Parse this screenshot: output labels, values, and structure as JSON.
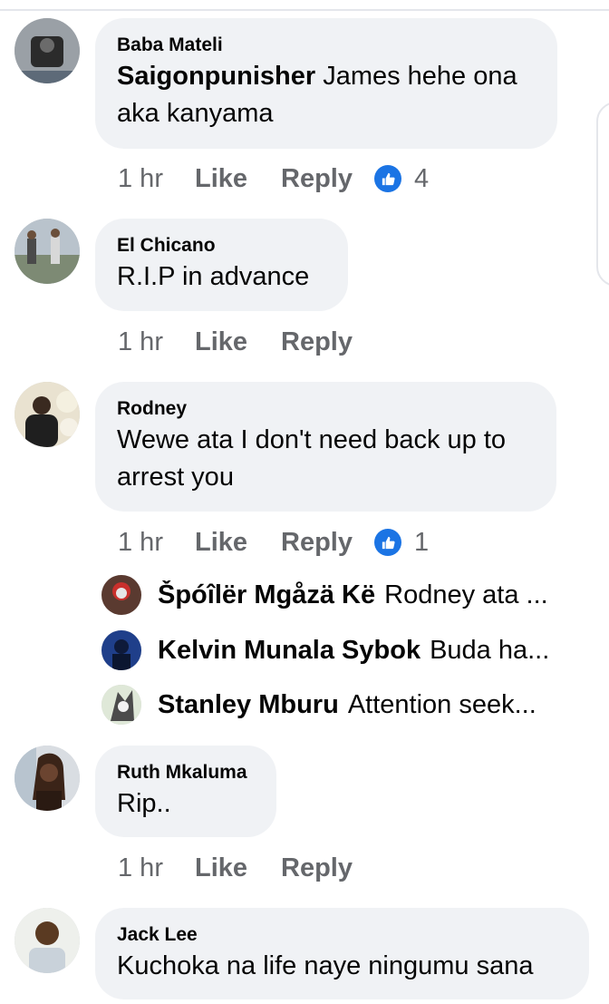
{
  "comments": [
    {
      "author": "Baba Mateli",
      "mention": "Saigonpunisher",
      "text": " James hehe ona aka kanyama",
      "time": "1 hr",
      "like": "Like",
      "reply": "Reply",
      "reactions": "4"
    },
    {
      "author": "El Chicano",
      "text": "R.I.P in advance",
      "time": "1 hr",
      "like": "Like",
      "reply": "Reply"
    },
    {
      "author": "Rodney",
      "text": "Wewe ata I don't need back up to arrest you",
      "time": "1 hr",
      "like": "Like",
      "reply": "Reply",
      "reactions": "1"
    },
    {
      "author": "Ruth Mkaluma",
      "text": "Rip..",
      "time": "1 hr",
      "like": "Like",
      "reply": "Reply"
    },
    {
      "author": "Jack Lee",
      "text": "Kuchoka na life naye ningumu sana"
    }
  ],
  "replies": [
    {
      "name": "Špóîlër Mgåzä Kë",
      "text": "Rodney ata ..."
    },
    {
      "name": "Kelvin Munala Sybok",
      "text": "Buda ha..."
    },
    {
      "name": "Stanley Mburu",
      "text": "Attention seek..."
    }
  ],
  "colors": {
    "bubble": "#f0f2f5",
    "secondary_text": "#65676b",
    "like_blue": "#1b74e4"
  },
  "icons": {
    "reaction": "thumbs-up-icon"
  }
}
